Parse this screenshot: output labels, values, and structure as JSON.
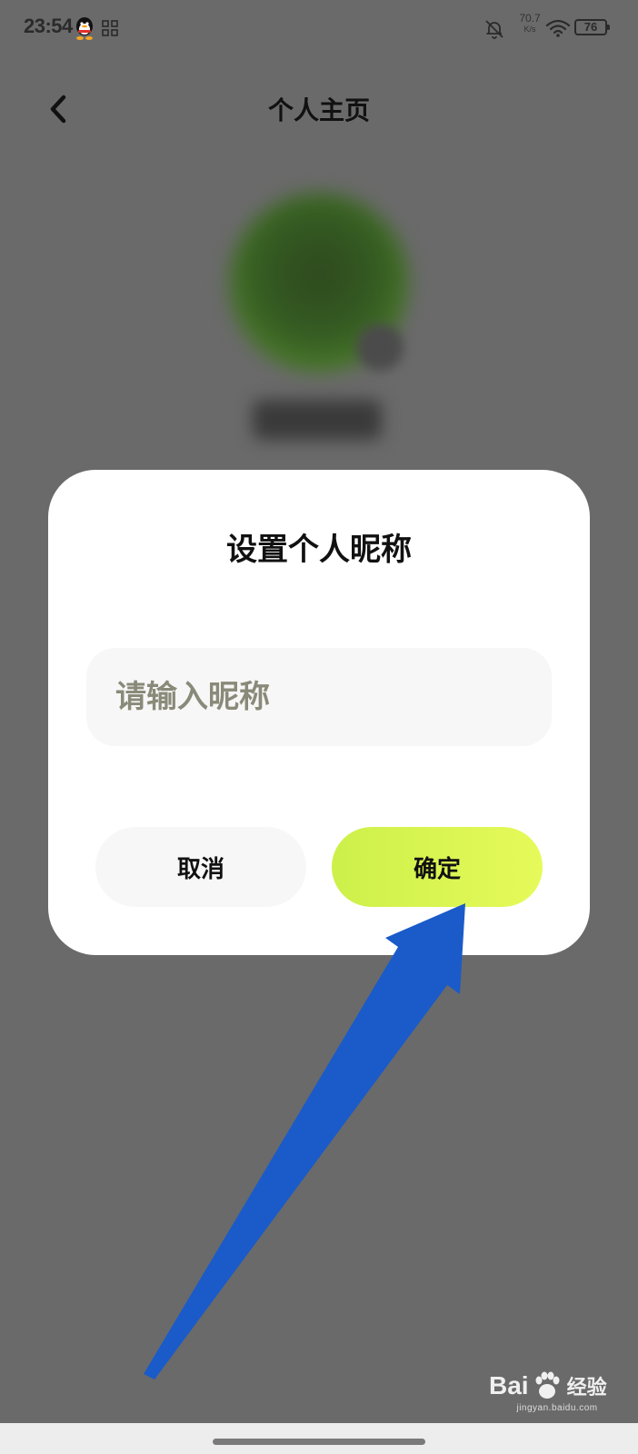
{
  "status_bar": {
    "time": "23:54",
    "net_speed_value": "70.7",
    "net_speed_unit": "K/s",
    "battery": "76",
    "icons": [
      "qq-icon",
      "qr-code-icon",
      "bell-off-icon",
      "wifi-icon",
      "battery-icon"
    ]
  },
  "header": {
    "back_icon": "chevron-left-icon",
    "title": "个人主页"
  },
  "dialog": {
    "title": "设置个人昵称",
    "input_placeholder": "请输入昵称",
    "input_value": "",
    "cancel_label": "取消",
    "confirm_label": "确定"
  },
  "watermark": {
    "brand_prefix": "Bai",
    "brand_suffix": "经验",
    "url": "jingyan.baidu.com"
  },
  "colors": {
    "overlay": "#6a6a6a",
    "dialog_bg": "#ffffff",
    "confirm_gradient_start": "#cdf04a",
    "confirm_gradient_end": "#e6fa5a",
    "cancel_bg": "#f7f7f7",
    "annotation_arrow": "#1a5bc9"
  }
}
